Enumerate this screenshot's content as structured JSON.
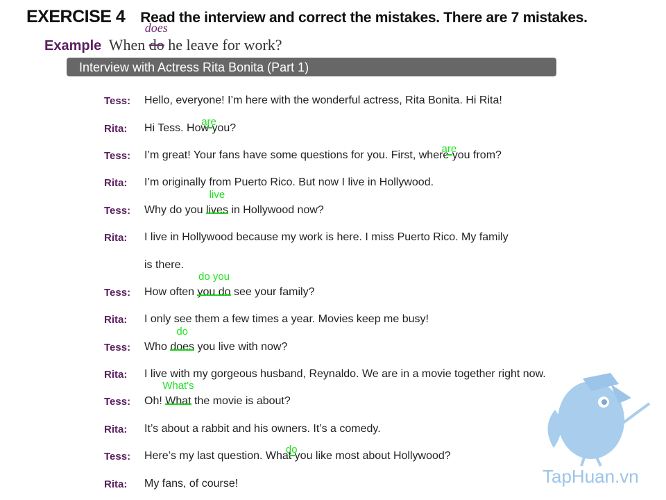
{
  "header": {
    "exercise_label": "EXERCISE 4",
    "instruction": "Read the interview and correct the mistakes. There are 7 mistakes."
  },
  "example": {
    "label": "Example",
    "before": "When ",
    "wrong": "do",
    "correction": "does",
    "after": " he leave for work?"
  },
  "title_bar": {
    "text": "Interview with Actress Rita Bonita (Part 1)"
  },
  "dialogue": [
    {
      "speaker": "Tess:",
      "parts": [
        {
          "t": "Hello, everyone! I’m here with the wonderful actress, Rita Bonita. Hi Rita!"
        }
      ]
    },
    {
      "speaker": "Rita:",
      "parts": [
        {
          "t": "Hi Tess. How"
        },
        {
          "c": "are",
          "w": ""
        },
        {
          "t": " you?"
        }
      ]
    },
    {
      "speaker": "Tess:",
      "parts": [
        {
          "t": "I’m great! Your fans have some questions for you. First, where"
        },
        {
          "c": "are",
          "w": ""
        },
        {
          "t": " you from?"
        }
      ]
    },
    {
      "speaker": "Rita:",
      "parts": [
        {
          "t": "I’m originally from Puerto Rico. But now I live in Hollywood."
        }
      ]
    },
    {
      "speaker": "Tess:",
      "parts": [
        {
          "t": "Why do you "
        },
        {
          "c": "live",
          "w": "lives"
        },
        {
          "t": " in Hollywood now?"
        }
      ]
    },
    {
      "speaker": "Rita:",
      "parts": [
        {
          "t": "I live in Hollywood because my work is here. I miss Puerto Rico. My family"
        }
      ]
    },
    {
      "speaker": "",
      "parts": [
        {
          "t": "is there."
        }
      ]
    },
    {
      "speaker": "Tess:",
      "parts": [
        {
          "t": "How often "
        },
        {
          "c": "do you",
          "w": "you do"
        },
        {
          "t": " see your family?"
        }
      ]
    },
    {
      "speaker": "Rita:",
      "parts": [
        {
          "t": "I only see them a few times a year. Movies keep me busy!"
        }
      ]
    },
    {
      "speaker": "Tess:",
      "parts": [
        {
          "t": "Who "
        },
        {
          "c": "do",
          "w": "does"
        },
        {
          "t": " you live with now?"
        }
      ]
    },
    {
      "speaker": "Rita:",
      "parts": [
        {
          "t": "I live with my gorgeous husband, Reynaldo. We are in a movie together right now."
        }
      ]
    },
    {
      "speaker": "Tess:",
      "parts": [
        {
          "t": "Oh! "
        },
        {
          "c": "What's",
          "w": "What"
        },
        {
          "t": " the movie is about?"
        }
      ]
    },
    {
      "speaker": "Rita:",
      "parts": [
        {
          "t": "It’s about a rabbit and his owners. It’s a comedy."
        }
      ]
    },
    {
      "speaker": "Tess:",
      "parts": [
        {
          "t": "Here’s my last question. What"
        },
        {
          "c": "do",
          "w": ""
        },
        {
          "t": " you like most about Hollywood?"
        }
      ]
    },
    {
      "speaker": "Rita:",
      "parts": [
        {
          "t": "My fans, of course!"
        }
      ]
    }
  ],
  "watermark": {
    "text": "TapHuan.vn"
  },
  "colors": {
    "speaker": "#5a1f5e",
    "correction": "#22e022",
    "title_bar": "#676767",
    "watermark": "#9cc4e8"
  }
}
